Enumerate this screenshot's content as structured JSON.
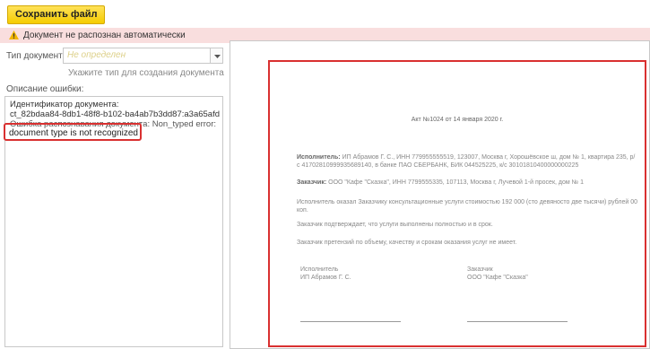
{
  "toolbar": {
    "save_label": "Сохранить файл"
  },
  "warning": {
    "text": "Документ не распознан автоматически",
    "color": "#f9dede"
  },
  "doc_type": {
    "label": "Тип документа:",
    "value": "Не определен",
    "hint": "Укажите тип для создания документа"
  },
  "error": {
    "label": "Описание ошибки:",
    "lines": [
      "Идентификатор документа:",
      "ct_82bdaa84-8db1-48f8-b102-ba4ab7b3dd87:a3a65afd",
      "Ошибка распознавания документа: Non_typed error:"
    ],
    "highlight": "document type is not recognized"
  },
  "preview": {
    "title": "Акт №1024 от 14 января 2020 г.",
    "executor_label": "Исполнитель:",
    "executor": "ИП Абрамов Г. С., ИНН 779955555519, 123007, Москва г, Хорошёвское ш, дом № 1, квартира 235, р/с 417028109999356891​40, в банке ПАО СБЕРБАНК, БИК 044525225, к/с 30101810400000000225",
    "customer_label": "Заказчик:",
    "customer": "ООО \"Кафе \"Сказка\", ИНН 7799555335, 107113, Москва г, Лучевой 1-й просек, дом № 1",
    "body1": "Исполнитель оказал Заказчику консультационные услуги стоимостью 192 000 (сто девяносто две тысячи) рублей 00 коп.",
    "body2": "Заказчик подтверждает, что услуги выполнены полностью и в срок.",
    "body3": "Заказчик претензий по объему, качеству и срокам оказания услуг не имеет.",
    "sig_left_role": "Исполнитель",
    "sig_left_name": "ИП Абрамов Г. С.",
    "sig_right_role": "Заказчик",
    "sig_right_name": "ООО \"Кафе \"Сказка\""
  },
  "colors": {
    "accent": "#f5cc00",
    "highlight_border": "#d93030"
  }
}
